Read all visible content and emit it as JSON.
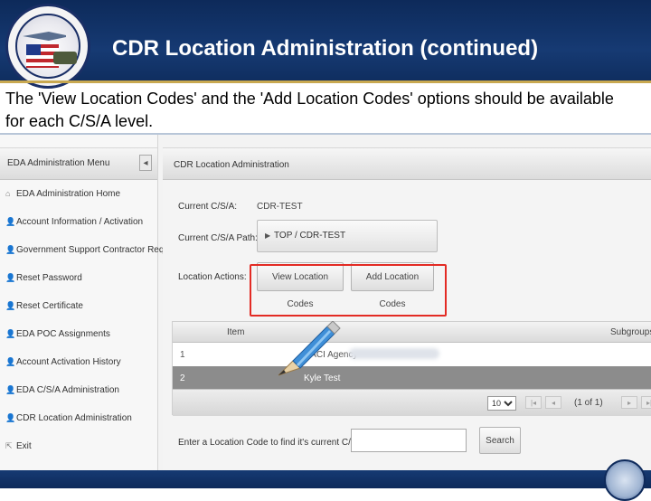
{
  "slide": {
    "title": "CDR Location Administration (continued)",
    "intro": "The 'View Location Codes' and the 'Add Location Codes' options should be available for each C/S/A level."
  },
  "sidebar": {
    "header": "EDA Administration Menu",
    "collapse_glyph": "◂",
    "items": [
      {
        "label": "EDA Administration Home",
        "icon": "home-icon",
        "glyph": "⌂"
      },
      {
        "label": "Account Information / Activation",
        "icon": "person-icon",
        "glyph": "👤"
      },
      {
        "label": "Government Support Contractor Request",
        "icon": "person-icon",
        "glyph": "👤"
      },
      {
        "label": "Reset Password",
        "icon": "person-icon",
        "glyph": "👤"
      },
      {
        "label": "Reset Certificate",
        "icon": "person-icon",
        "glyph": "👤"
      },
      {
        "label": "EDA POC Assignments",
        "icon": "person-icon",
        "glyph": "👤"
      },
      {
        "label": "Account Activation History",
        "icon": "person-icon",
        "glyph": "👤"
      },
      {
        "label": "EDA C/S/A Administration",
        "icon": "person-icon",
        "glyph": "👤"
      },
      {
        "label": "CDR Location Administration",
        "icon": "person-icon",
        "glyph": "👤"
      },
      {
        "label": "Exit",
        "icon": "exit-icon",
        "glyph": "⇱"
      }
    ]
  },
  "main": {
    "header": "CDR Location Administration",
    "current_csa_label": "Current C/S/A:",
    "current_csa_value": "CDR-TEST",
    "current_path_label": "Current C/S/A Path:",
    "current_path_value": "TOP / CDR-TEST",
    "path_arrow": "▶",
    "location_actions_label": "Location Actions:",
    "view_button": "View Location Codes",
    "add_button": "Add Location Codes",
    "table": {
      "columns": [
        "Item",
        "Subgroups"
      ],
      "rows": [
        {
          "item": "1",
          "name": "CACI Agency"
        },
        {
          "item": "2",
          "name": "Kyle Test"
        }
      ]
    },
    "pager": {
      "page_size": "10",
      "page_indicator": "(1 of 1)",
      "first_glyph": "|◂",
      "prev_glyph": "◂",
      "next_glyph": "▸",
      "last_glyph": "▸|"
    },
    "search_label": "Enter a Location Code to find it's current C/S/A:",
    "search_value": "",
    "search_button": "Search"
  },
  "colors": {
    "header_blue": "#163a73",
    "highlight_red": "#e32b24",
    "selected_row": "#8c8c8c"
  }
}
